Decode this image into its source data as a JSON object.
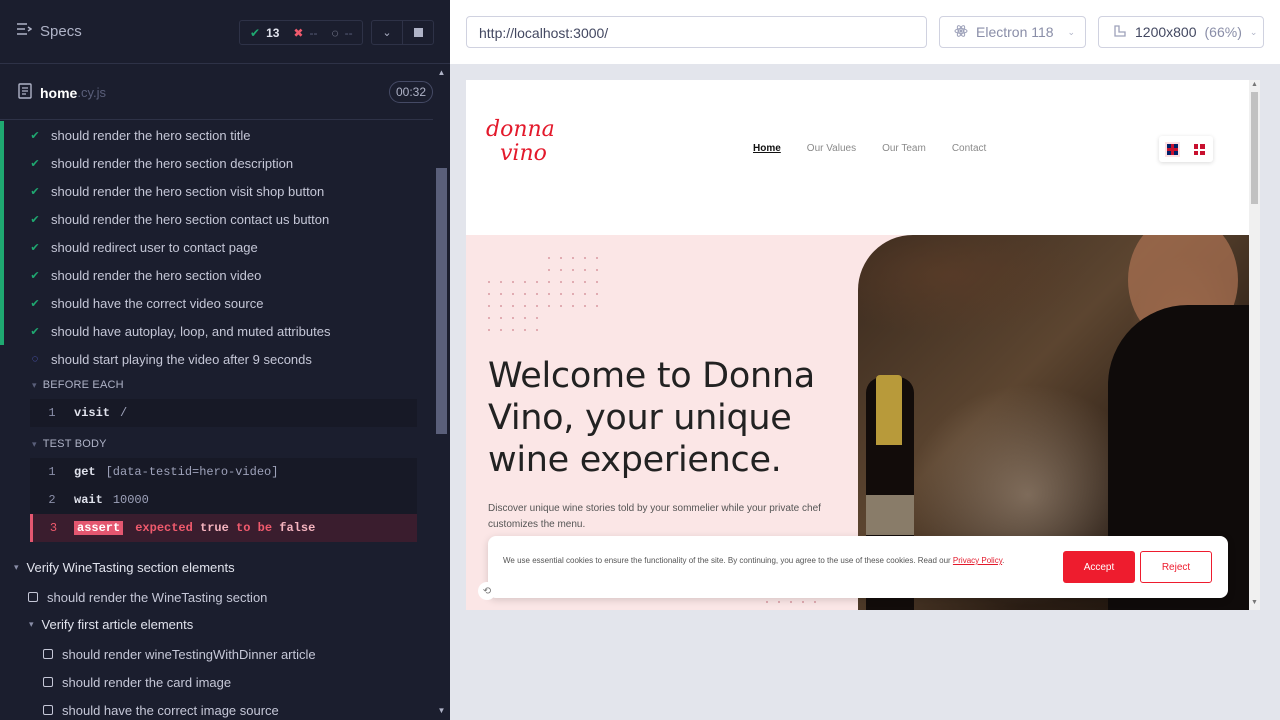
{
  "reporter": {
    "specs_label": "Specs",
    "stats": {
      "passed": "13",
      "failed": "--",
      "pending": "--"
    },
    "spec_name": "home",
    "spec_ext": ".cy.js",
    "duration": "00:32",
    "tests": [
      "should render the hero section title",
      "should render the hero section description",
      "should render the hero section visit shop button",
      "should render the hero section contact us button",
      "should redirect user to contact page",
      "should render the hero section video",
      "should have the correct video source",
      "should have autoplay, loop, and muted attributes"
    ],
    "running_test": "should start playing the video after 9 seconds",
    "before_each_label": "BEFORE EACH",
    "before_each_cmd": {
      "num": "1",
      "name": "visit",
      "arg": "/"
    },
    "test_body_label": "TEST BODY",
    "test_body_cmds": [
      {
        "num": "1",
        "name": "get",
        "arg": "[data-testid=hero-video]"
      },
      {
        "num": "2",
        "name": "wait",
        "arg": "10000"
      }
    ],
    "fail_cmd": {
      "num": "3",
      "name": "assert",
      "m1": "expected",
      "w1": "true",
      "m2": "to be",
      "w2": "false"
    },
    "suite2_title": "Verify WineTasting section elements",
    "suite2_test": "should render the WineTasting section",
    "suite3_title": "Verify first article elements",
    "suite3_tests": [
      "should render wineTestingWithDinner article",
      "should render the card image",
      "should have the correct image source"
    ]
  },
  "aut": {
    "url": "http://localhost:3000/",
    "browser": "Electron 118",
    "viewport": "1200x800",
    "zoom": "(66%)"
  },
  "site": {
    "logo_line1": "donna",
    "logo_line2": "vino",
    "nav": [
      "Home",
      "Our Values",
      "Our Team",
      "Contact"
    ],
    "hero_title": "Welcome to Donna Vino, your unique wine experience.",
    "hero_desc": "Discover unique wine stories told by your sommelier while your private chef customizes the menu.",
    "cookie_text": "We use essential cookies to ensure the functionality of the site. By continuing, you agree to the use of these cookies. Read our",
    "cookie_link": "Privacy Policy",
    "accept": "Accept",
    "reject": "Reject",
    "colors": {
      "brand_red": "#ee1c2e",
      "hero_bg": "#fbe6e6",
      "pass_green": "#1fa971",
      "fail_red": "#e45770"
    }
  }
}
